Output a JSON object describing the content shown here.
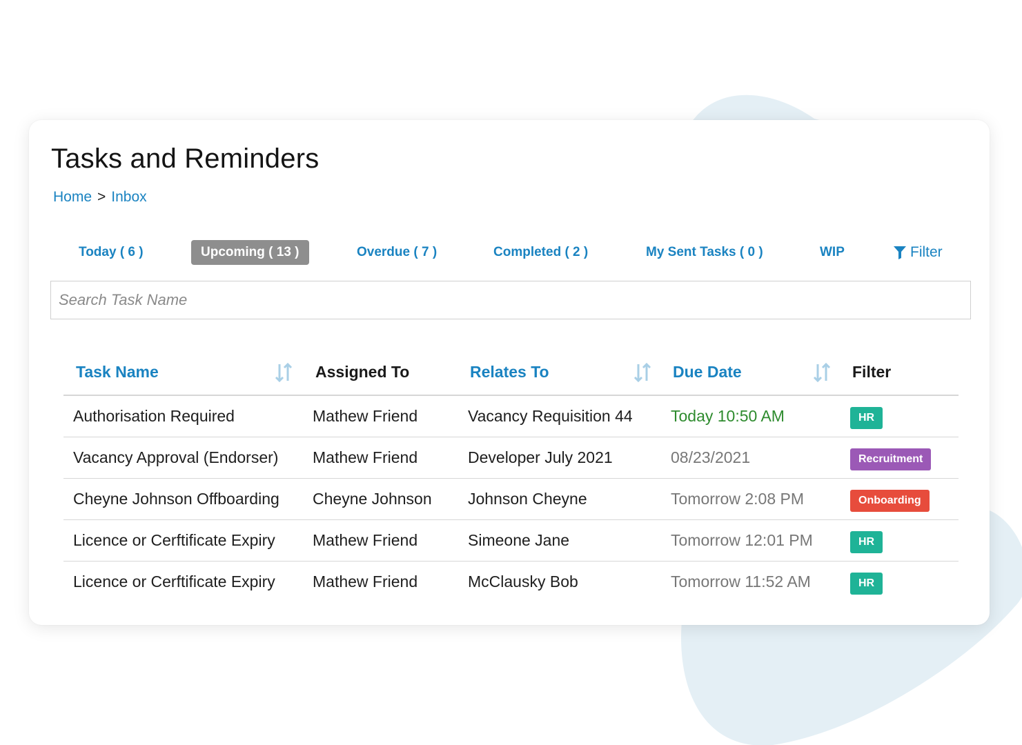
{
  "page": {
    "title": "Tasks and Reminders",
    "breadcrumb": {
      "home": "Home",
      "separator": ">",
      "current": "Inbox"
    }
  },
  "tabs": [
    {
      "label": "Today ( 6 )",
      "active": false
    },
    {
      "label": "Upcoming ( 13 )",
      "active": true
    },
    {
      "label": "Overdue ( 7 )",
      "active": false
    },
    {
      "label": "Completed ( 2 )",
      "active": false
    },
    {
      "label": "My Sent Tasks ( 0 )",
      "active": false
    },
    {
      "label": "WIP",
      "active": false
    }
  ],
  "filter_button": {
    "label": "Filter",
    "icon": "funnel-icon"
  },
  "search": {
    "placeholder": "Search Task Name",
    "value": ""
  },
  "table": {
    "headers": {
      "task_name": "Task Name",
      "assigned_to": "Assigned To",
      "relates_to": "Relates To",
      "due_date": "Due Date",
      "filter": "Filter"
    },
    "rows": [
      {
        "task": "Authorisation Required",
        "assigned": "Mathew Friend",
        "relates": "Vacancy Requisition 44",
        "due": "Today 10:50 AM",
        "tag": "HR"
      },
      {
        "task": "Vacancy Approval (Endorser)",
        "assigned": "Mathew Friend",
        "relates": "Developer July 2021",
        "due": "08/23/2021",
        "tag": "Recruitment"
      },
      {
        "task": "Cheyne Johnson Offboarding",
        "assigned": "Cheyne Johnson",
        "relates": "Johnson Cheyne",
        "due": "Tomorrow 2:08 PM",
        "tag": "Onboarding"
      },
      {
        "task": "Licence or Cerftificate Expiry",
        "assigned": "Mathew Friend",
        "relates": "Simeone Jane",
        "due": "Tomorrow 12:01 PM",
        "tag": "HR"
      },
      {
        "task": "Licence or Cerftificate Expiry",
        "assigned": "Mathew Friend",
        "relates": "McClausky Bob",
        "due": "Tomorrow 11:52 AM",
        "tag": "HR"
      }
    ]
  },
  "colors": {
    "link": "#1a83c1",
    "active_tab": "#8e8e8e",
    "due_today": "#2e8b2e",
    "due_other": "#777777",
    "tag_hr": "#1fb397",
    "tag_recruitment": "#9b59b6",
    "tag_onboarding": "#e74c3c",
    "background_blob": "#e4eff5"
  }
}
